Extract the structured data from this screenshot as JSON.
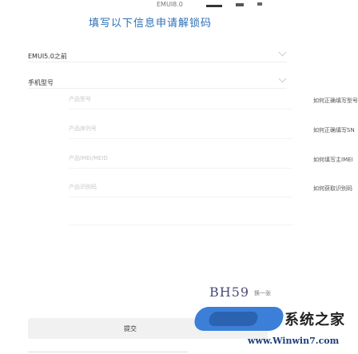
{
  "top": {
    "text": "EMUI8.0"
  },
  "heading": "填写以下信息申请解锁码",
  "form": {
    "version_label": "EMUI5.0之前",
    "model_label": "手机型号",
    "fields": [
      {
        "placeholder": "产品型号",
        "hint": "如何正确填写型号"
      },
      {
        "placeholder": "产品序列号",
        "hint": "如何正确填写SN"
      },
      {
        "placeholder": "产品IMEI/MEID",
        "hint": "如何填写主IMEI"
      },
      {
        "placeholder": "产品识别码",
        "hint": "如何获取识别码"
      }
    ],
    "captcha": "BH59",
    "refresh": "换一张",
    "submit": "提交"
  },
  "watermark": {
    "brand": "系统之家",
    "url": "www.Winwin7.com"
  }
}
